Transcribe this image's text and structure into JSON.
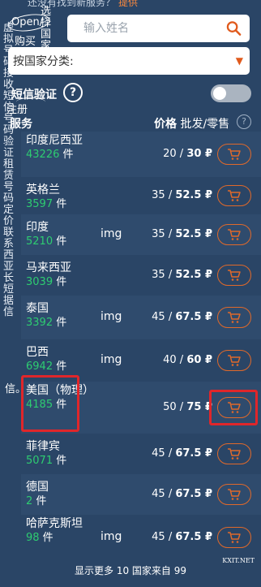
{
  "top_notice": {
    "text": "还没有找到新服务？",
    "link": "提供"
  },
  "left_nav": {
    "open_label": "Open/",
    "buy_label": "购买",
    "select_country": "选择国家",
    "register_label": "注册",
    "stack": [
      "虚",
      "拟",
      "号",
      "码",
      "接",
      "收",
      "短",
      "信",
      "号",
      "码",
      "验",
      "证",
      "租",
      "赁",
      "号",
      "码",
      "定",
      "价",
      "联",
      "系",
      "西",
      "亚",
      "长",
      "短",
      "据",
      "信"
    ]
  },
  "search": {
    "placeholder": "输入姓名"
  },
  "country_select": {
    "value": "按国家分类:"
  },
  "verify": {
    "label": "短信验证",
    "help": "?"
  },
  "table_header": {
    "service": "服务",
    "price_bold": "价格",
    "price_rest": " 批发/零售",
    "help": "?"
  },
  "rows": [
    {
      "name": "印度尼西亚",
      "count": "43226",
      "unit": " 件",
      "img": "",
      "wholesale": "20",
      "retail": "30 ₽"
    },
    {
      "name": "英格兰",
      "count": "3597",
      "unit": " 件",
      "img": "",
      "wholesale": "35",
      "retail": "52.5 ₽"
    },
    {
      "name": "印度",
      "count": "5210",
      "unit": " 件",
      "img": "img",
      "wholesale": "35",
      "retail": "52.5 ₽"
    },
    {
      "name": "马来西亚",
      "count": "3039",
      "unit": " 件",
      "img": "",
      "wholesale": "35",
      "retail": "52.5 ₽"
    },
    {
      "name": "泰国",
      "count": "3392",
      "unit": " 件",
      "img": "img",
      "wholesale": "45",
      "retail": "67.5 ₽"
    },
    {
      "name": "巴西",
      "count": "6942",
      "unit": " 件",
      "img": "img",
      "wholesale": "40",
      "retail": "60 ₽"
    },
    {
      "name": "美国（物理）",
      "count": "4185",
      "unit": " 件",
      "img": "",
      "wholesale": "50",
      "retail": "75 ₽"
    },
    {
      "name": "菲律宾",
      "count": "5071",
      "unit": " 件",
      "img": "",
      "wholesale": "45",
      "retail": "67.5 ₽"
    },
    {
      "name": "德国",
      "count": "2",
      "unit": " 件",
      "img": "",
      "wholesale": "45",
      "retail": "67.5 ₽"
    },
    {
      "name": "哈萨克斯坦",
      "count": "98",
      "unit": " 件",
      "img": "img",
      "wholesale": "45",
      "retail": "67.5 ₽"
    }
  ],
  "xin_label": "信。",
  "footer": {
    "text": "显示更多 10 国家来自 99"
  },
  "watermark": "KXIT.NET",
  "colors": {
    "background": "#2a4566",
    "accent": "#e0692a",
    "count": "#2ecc71",
    "highlight": "#e0262a"
  }
}
